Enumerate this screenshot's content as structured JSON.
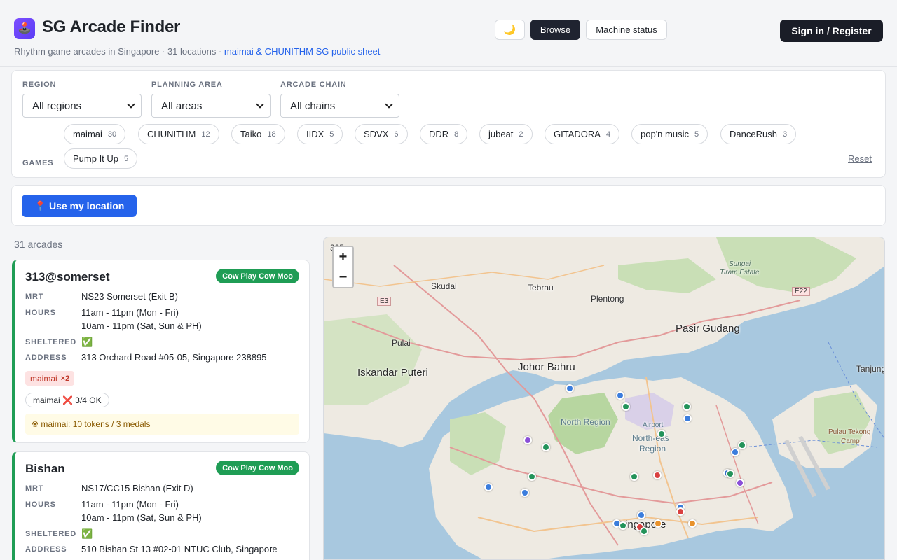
{
  "header": {
    "logo_glyph": "🕹️",
    "title": "SG Arcade Finder",
    "subtitle_prefix": "Rhythm game arcades in Singapore · 31 locations · ",
    "subtitle_link": "maimai & CHUNITHM SG public sheet",
    "theme_toggle_glyph": "🌙",
    "browse_label": "Browse",
    "machine_status_label": "Machine status",
    "signin_label": "Sign in / Register"
  },
  "filters": {
    "region_label": "REGION",
    "region_value": "All regions",
    "area_label": "PLANNING AREA",
    "area_value": "All areas",
    "chain_label": "ARCADE CHAIN",
    "chain_value": "All chains",
    "games_label": "GAMES",
    "reset_label": "Reset",
    "games": [
      {
        "name": "maimai",
        "count": "30"
      },
      {
        "name": "CHUNITHM",
        "count": "12"
      },
      {
        "name": "Taiko",
        "count": "18"
      },
      {
        "name": "IIDX",
        "count": "5"
      },
      {
        "name": "SDVX",
        "count": "6"
      },
      {
        "name": "DDR",
        "count": "8"
      },
      {
        "name": "jubeat",
        "count": "2"
      },
      {
        "name": "GITADORA",
        "count": "4"
      },
      {
        "name": "pop'n music",
        "count": "5"
      },
      {
        "name": "DanceRush",
        "count": "3"
      },
      {
        "name": "Pump It Up",
        "count": "5"
      }
    ]
  },
  "location": {
    "button_label": "📍 Use my location"
  },
  "results": {
    "count_label": "31 arcades"
  },
  "arcades": [
    {
      "name": "313@somerset",
      "chain": "Cow Play Cow Moo",
      "mrt_label": "MRT",
      "mrt": "NS23 Somerset (Exit B)",
      "hours_label": "HOURS",
      "hours_1": "11am - 11pm (Mon - Fri)",
      "hours_2": "10am - 11pm (Sat, Sun & PH)",
      "sheltered_label": "SHELTERED",
      "sheltered": "✅",
      "address_label": "ADDRESS",
      "address": "313 Orchard Road #05-05, Singapore 238895",
      "game_tag": "maimai",
      "game_tag_count": "×2",
      "machine_status": "maimai ❌ 3/4 OK",
      "note": "※ maimai: 10 tokens / 3 medals"
    },
    {
      "name": "Bishan",
      "chain": "Cow Play Cow Moo",
      "mrt_label": "MRT",
      "mrt": "NS17/CC15 Bishan (Exit D)",
      "hours_label": "HOURS",
      "hours_1": "11am - 11pm (Mon - Fri)",
      "hours_2": "10am - 11pm (Sat, Sun & PH)",
      "sheltered_label": "SHELTERED",
      "sheltered": "✅",
      "address_label": "ADDRESS",
      "address": "510 Bishan St 13 #02-01 NTUC Club, Singapore"
    }
  ],
  "map": {
    "zoom_in": "+",
    "zoom_out": "−",
    "labels": {
      "johor_bahru": "Johor Bahru",
      "iskandar": "Iskandar Puteri",
      "pasir_gudang": "Pasir Gudang",
      "skudai": "Skudai",
      "tebrau": "Tebrau",
      "plentong": "Plentong",
      "pulai": "Pulai",
      "north_region": "North Region",
      "north_east_1": "North-eas",
      "north_east_2": "Region",
      "singapore": "Singapore",
      "pulau_tekong_1": "Pulau Tekong",
      "pulau_tekong_2": "Camp",
      "tanjung": "Tanjung",
      "sungai_1": "Sungai",
      "sungai_2": "Tiram Estate",
      "e3": "E3",
      "e22": "E22",
      "airport": "Airport"
    },
    "marker_colors": {
      "blue": "#3b7ddd",
      "green": "#23935a",
      "red": "#d94040",
      "orange": "#e8922c",
      "purple": "#8a4fd8"
    }
  }
}
